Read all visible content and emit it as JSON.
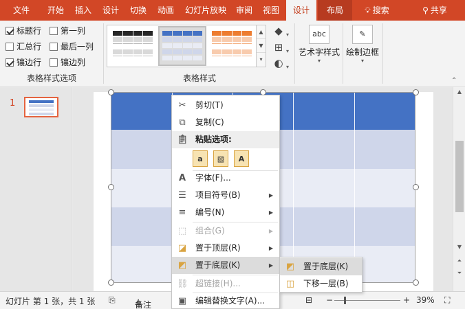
{
  "tabs": [
    {
      "label": "文件"
    },
    {
      "label": "开始"
    },
    {
      "label": "插入"
    },
    {
      "label": "设计"
    },
    {
      "label": "切换"
    },
    {
      "label": "动画"
    },
    {
      "label": "幻灯片放映"
    },
    {
      "label": "审阅"
    },
    {
      "label": "视图"
    },
    {
      "label": "设计"
    },
    {
      "label": "布局"
    },
    {
      "label": "搜索"
    },
    {
      "label": "共享"
    }
  ],
  "ribbon": {
    "style_options": {
      "label": "表格样式选项",
      "checkboxes": [
        {
          "label": "标题行",
          "checked": true
        },
        {
          "label": "第一列",
          "checked": false
        },
        {
          "label": "汇总行",
          "checked": false
        },
        {
          "label": "最后一列",
          "checked": false
        },
        {
          "label": "镶边行",
          "checked": true
        },
        {
          "label": "镶边列",
          "checked": false
        }
      ]
    },
    "table_styles": {
      "label": "表格样式",
      "styles": [
        {
          "header": "#262626",
          "band": "#d9d9d9"
        },
        {
          "header": "#4472c4",
          "band": "#cfd6ea"
        },
        {
          "header": "#ed7d31",
          "band": "#f8cbad"
        }
      ]
    },
    "wordart": {
      "label": "艺术字样式",
      "icon_text": "abc"
    },
    "borders": {
      "label": "绘制边框"
    }
  },
  "slide_panel": {
    "slide_number": "1"
  },
  "colors": {
    "accent": "#d24726",
    "table_header": "#4472c4",
    "table_band": "#cfd6ea",
    "table_band_alt": "#e9ecf5"
  },
  "context_menu": {
    "items": [
      {
        "label": "剪切(T)",
        "icon": "scissors-icon"
      },
      {
        "label": "复制(C)",
        "icon": "copy-icon"
      },
      {
        "label": "粘贴选项:",
        "icon": "paste-icon"
      },
      {
        "label": "字体(F)...",
        "icon": "font-icon"
      },
      {
        "label": "项目符号(B)",
        "icon": "bullets-icon"
      },
      {
        "label": "编号(N)",
        "icon": "numbering-icon"
      },
      {
        "label": "组合(G)",
        "icon": "group-icon"
      },
      {
        "label": "置于顶层(R)",
        "icon": "bring-front-icon"
      },
      {
        "label": "置于底层(K)",
        "icon": "send-back-icon"
      },
      {
        "label": "超链接(H)...",
        "icon": "link-icon"
      },
      {
        "label": "编辑替换文字(A)...",
        "icon": "alt-text-icon"
      }
    ],
    "paste_icons": [
      "a",
      "",
      "A"
    ]
  },
  "submenu": {
    "items": [
      {
        "label": "置于底层(K)"
      },
      {
        "label": "下移一层(B)"
      }
    ]
  },
  "status_bar": {
    "slide_info": "幻灯片 第 1 张，共 1 张",
    "notes": "备注",
    "zoom_minus": "−",
    "zoom_plus": "+",
    "zoom": "39%"
  }
}
